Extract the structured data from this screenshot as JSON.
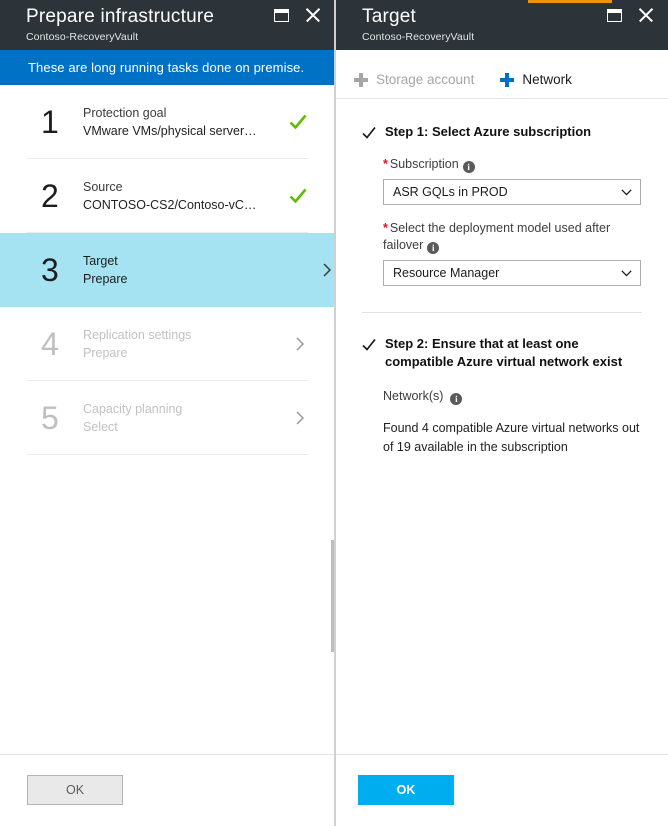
{
  "accent_color": "#f2910a",
  "left_blade": {
    "header": {
      "title": "Prepare infrastructure",
      "subtitle": "Contoso-RecoveryVault"
    },
    "banner": "These are long running tasks done on premise.",
    "steps": [
      {
        "num": "1",
        "title": "Protection goal",
        "desc": "VMware VMs/physical servers t...",
        "state": "done"
      },
      {
        "num": "2",
        "title": "Source",
        "desc": "CONTOSO-CS2/Contoso-vCent...",
        "state": "done"
      },
      {
        "num": "3",
        "title": "Target",
        "desc": "Prepare",
        "state": "selected"
      },
      {
        "num": "4",
        "title": "Replication settings",
        "desc": "Prepare",
        "state": "disabled"
      },
      {
        "num": "5",
        "title": "Capacity planning",
        "desc": "Select",
        "state": "disabled"
      }
    ],
    "footer": {
      "ok_label": "OK"
    }
  },
  "right_blade": {
    "header": {
      "title": "Target",
      "subtitle": "Contoso-RecoveryVault"
    },
    "toolbar": {
      "storage_account_label": "Storage account",
      "network_label": "Network"
    },
    "step1": {
      "title": "Step 1: Select Azure subscription",
      "subscription": {
        "label": "Subscription",
        "value": "ASR GQLs in PROD"
      },
      "deployment_model": {
        "label": "Select the deployment model used after failover",
        "value": "Resource Manager"
      }
    },
    "step2": {
      "title": "Step 2: Ensure that at least one compatible Azure virtual network exist",
      "networks_label": "Network(s)",
      "result_text": "Found 4 compatible Azure virtual networks out of 19 available in the subscription"
    },
    "footer": {
      "ok_label": "OK"
    }
  }
}
